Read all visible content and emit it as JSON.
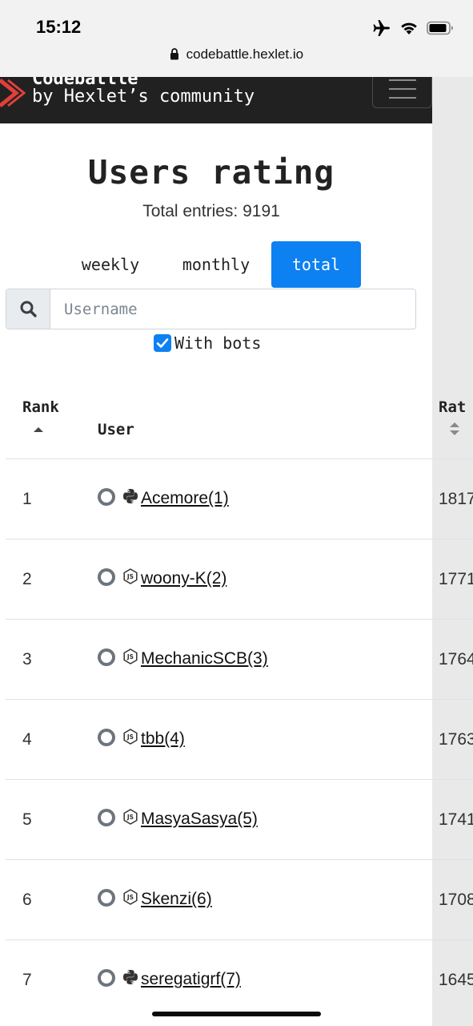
{
  "status_bar": {
    "time": "15:12",
    "icons": [
      "airplane-icon",
      "wifi-icon",
      "battery-icon"
    ]
  },
  "browser": {
    "url": "codebattle.hexlet.io"
  },
  "navbar": {
    "brand_name": "Codebattle",
    "brand_sub": "by Hexlet’s community"
  },
  "main": {
    "title": "Users rating",
    "total_entries": "Total entries: 9191",
    "tabs": [
      {
        "label": "weekly",
        "active": false
      },
      {
        "label": "monthly",
        "active": false
      },
      {
        "label": "total",
        "active": true
      }
    ],
    "search_placeholder": "Username",
    "with_bots_label": "With bots",
    "with_bots_checked": true
  },
  "table": {
    "headers": {
      "rank": "Rank",
      "user": "User",
      "rating": "Rat"
    },
    "rows": [
      {
        "rank": "1",
        "lang": "python",
        "user": "Acemore(1)",
        "rating": "1817"
      },
      {
        "rank": "2",
        "lang": "js",
        "user": "woony-K(2)",
        "rating": "1771"
      },
      {
        "rank": "3",
        "lang": "js",
        "user": "MechanicSCB(3)",
        "rating": "1764"
      },
      {
        "rank": "4",
        "lang": "js",
        "user": "tbb(4)",
        "rating": "1763"
      },
      {
        "rank": "5",
        "lang": "js",
        "user": "MasyaSasya(5)",
        "rating": "1741"
      },
      {
        "rank": "6",
        "lang": "js",
        "user": "Skenzi(6)",
        "rating": "1708"
      },
      {
        "rank": "7",
        "lang": "python",
        "user": "seregatigrf(7)",
        "rating": "1645"
      }
    ]
  },
  "colors": {
    "accent": "#0d80f2",
    "navbar": "#212121",
    "logo_red": "#e0403a"
  }
}
